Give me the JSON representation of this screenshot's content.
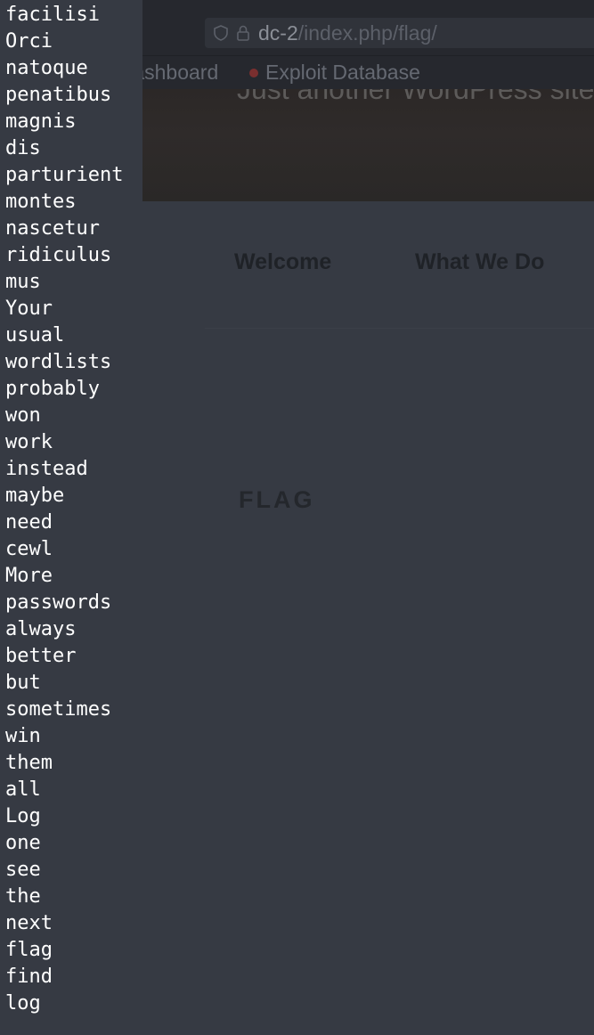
{
  "browser": {
    "url_host": "dc-2",
    "url_path": "/index.php/flag/",
    "bookmarks": [
      {
        "label": "ux - Dashboard"
      },
      {
        "label": "Exploit Database"
      }
    ],
    "site_tagline": "Just another WordPress site",
    "nav": [
      {
        "label": "Welcome"
      },
      {
        "label": "What We Do"
      }
    ],
    "page_heading": "FLAG"
  },
  "terminal": {
    "words": [
      "facilisi",
      "Orci",
      "natoque",
      "penatibus",
      "magnis",
      "dis",
      "parturient",
      "montes",
      "nascetur",
      "ridiculus",
      "mus",
      "Your",
      "usual",
      "wordlists",
      "probably",
      "won",
      "work",
      "instead",
      "maybe",
      "need",
      "cewl",
      "More",
      "passwords",
      "always",
      "better",
      "but",
      "sometimes",
      "win",
      "them",
      "all",
      "Log",
      "one",
      "see",
      "the",
      "next",
      "flag",
      "find",
      "log"
    ]
  },
  "colors": {
    "terminal_bg": "#363a43",
    "terminal_text": "#ffffff",
    "browser_chrome": "#26282e"
  }
}
